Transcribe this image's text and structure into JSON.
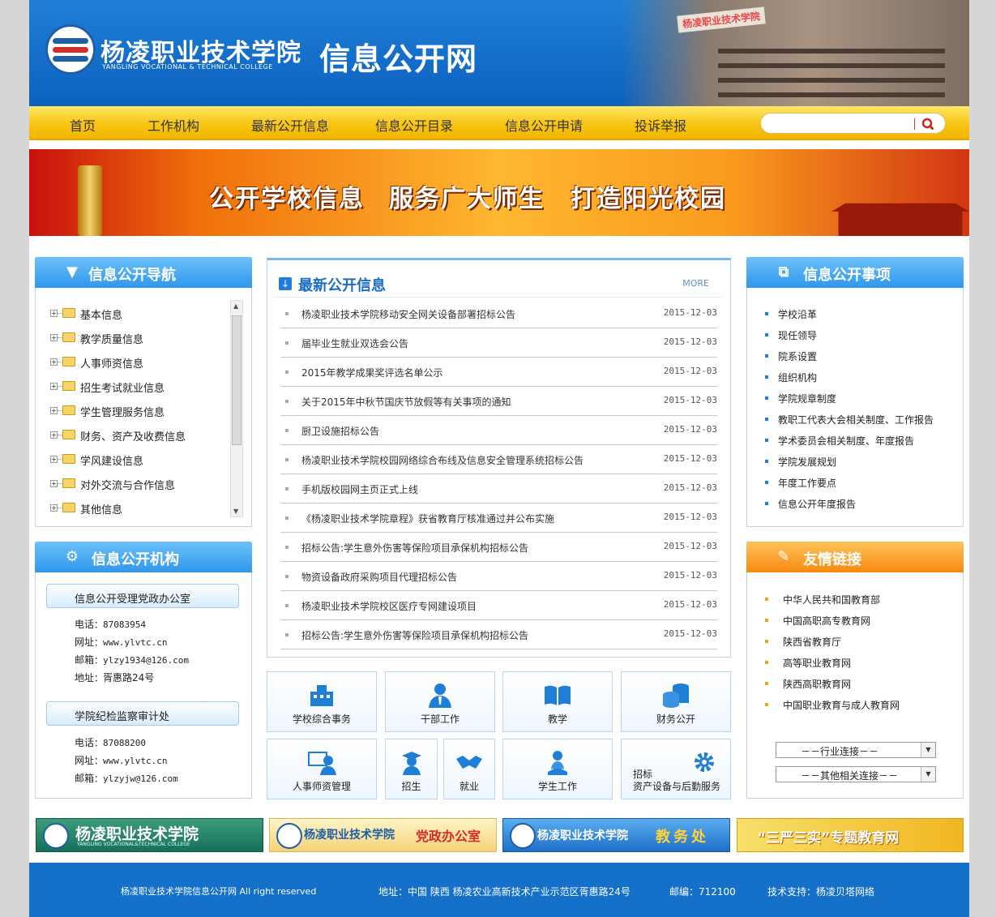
{
  "header": {
    "college_name": "杨凌职业技术学院",
    "college_name_en": "YANGLING VOCATIONAL & TECHNICAL COLLEGE",
    "site_title": "信息公开网",
    "building_sign": "杨凌职业技术学院"
  },
  "nav": {
    "items": [
      "首页",
      "工作机构",
      "最新公开信息",
      "信息公开目录",
      "信息公开申请",
      "投诉举报"
    ],
    "search_placeholder": ""
  },
  "banner": {
    "slogans": [
      "公开学校信息",
      "服务广大师生",
      "打造阳光校园"
    ]
  },
  "left_nav": {
    "title": "信息公开导航",
    "items": [
      "基本信息",
      "教学质量信息",
      "人事师资信息",
      "招生考试就业信息",
      "学生管理服务信息",
      "财务、资产及收费信息",
      "学风建设信息",
      "对外交流与合作信息",
      "其他信息"
    ]
  },
  "org": {
    "title": "信息公开机构",
    "offices": [
      {
        "name": "信息公开受理党政办公室",
        "lines": [
          [
            "电话",
            "87083954"
          ],
          [
            "网址",
            "www.ylvtc.cn"
          ],
          [
            "邮箱",
            "ylzy1934@126.com"
          ],
          [
            "地址",
            "胥惠路24号"
          ]
        ]
      },
      {
        "name": "学院纪检监察审计处",
        "lines": [
          [
            "电话",
            "87088200"
          ],
          [
            "网址",
            "www.ylvtc.cn"
          ],
          [
            "邮箱",
            "ylzyjw@126.com"
          ]
        ]
      }
    ]
  },
  "news": {
    "title": "最新公开信息",
    "more": "MORE",
    "items": [
      {
        "title": "杨凌职业技术学院移动安全网关设备部署招标公告",
        "date": "2015-12-03"
      },
      {
        "title": "届毕业生就业双选会公告",
        "date": "2015-12-03"
      },
      {
        "title": "2015年教学成果奖评选名单公示",
        "date": "2015-12-03"
      },
      {
        "title": "关于2015年中秋节国庆节放假等有关事项的通知",
        "date": "2015-12-03"
      },
      {
        "title": "厨卫设施招标公告",
        "date": "2015-12-03"
      },
      {
        "title": "杨凌职业技术学院校园网络综合布线及信息安全管理系统招标公告",
        "date": "2015-12-03"
      },
      {
        "title": "手机版校园网主页正式上线",
        "date": "2015-12-03"
      },
      {
        "title": "《杨凌职业技术学院章程》获省教育厅核准通过并公布实施",
        "date": "2015-12-03"
      },
      {
        "title": "招标公告:学生意外伤害等保险项目承保机构招标公告",
        "date": "2015-12-03"
      },
      {
        "title": "物资设备政府采购项目代理招标公告",
        "date": "2015-12-03"
      },
      {
        "title": "杨凌职业技术学院校区医疗专网建设项目",
        "date": "2015-12-03"
      },
      {
        "title": "招标公告:学生意外伤害等保险项目承保机构招标公告",
        "date": "2015-12-03"
      }
    ]
  },
  "tiles": {
    "row1": [
      "学校综合事务",
      "干部工作",
      "教学",
      "财务公开"
    ],
    "row2": [
      "人事师资管理",
      "招生",
      "就业",
      "学生工作"
    ],
    "last_line1": "招标",
    "last_line2": "资产设备与后勤服务"
  },
  "matters": {
    "title": "信息公开事项",
    "items": [
      "学校沿革",
      "现任领导",
      "院系设置",
      "组织机构",
      "学院规章制度",
      "教职工代表大会相关制度、工作报告",
      "学术委员会相关制度、年度报告",
      "学院发展规划",
      "年度工作要点",
      "信息公开年度报告"
    ]
  },
  "links": {
    "title": "友情链接",
    "items": [
      "中华人民共和国教育部",
      "中国高职高专教育网",
      "陕西省教育厅",
      "高等职业教育网",
      "陕西高职教育网",
      "中国职业教育与成人教育网"
    ],
    "select1": "－－行业连接－－",
    "select2": "－－其他相关连接－－"
  },
  "bottom_banners": [
    {
      "text": "杨凌职业技术学院",
      "sub": "YANGLING VOCATIONAL&TECHNICAL COLLEGE"
    },
    {
      "text": "杨凌职业技术学院",
      "tag": "党政办公室"
    },
    {
      "text": "杨凌职业技术学院",
      "tag": "教务处"
    },
    {
      "text": "“三严三实”专题教育网"
    }
  ],
  "footer": {
    "copyright": "杨凌职业技术学院信息公开网 All right reserved",
    "address": "地址：中国 陕西 杨凌农业高新技术产业示范区胥惠路24号",
    "postcode": "邮编：712100",
    "support": "技术支持：杨凌贝塔网络"
  },
  "colors": {
    "primary": "#1470c9",
    "nav_yellow": "#f7c514",
    "accent_orange": "#f68a10"
  },
  "icons": [
    "search-icon",
    "down-arrow-icon",
    "gear-icon",
    "windows-icon",
    "edit-icon",
    "download-icon"
  ]
}
